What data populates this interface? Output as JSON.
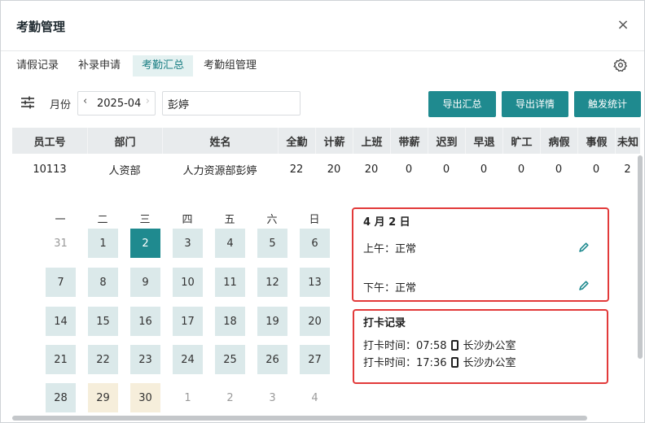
{
  "window": {
    "title": "考勤管理",
    "close_glyph": "×"
  },
  "tabs": [
    {
      "label": "请假记录",
      "active": false
    },
    {
      "label": "补录申请",
      "active": false
    },
    {
      "label": "考勤汇总",
      "active": true
    },
    {
      "label": "考勤组管理",
      "active": false
    }
  ],
  "toolbar": {
    "month_label": "月份",
    "month_value": "2025-04",
    "prev_glyph": "‹",
    "next_glyph": "›",
    "name_value": "彭婷",
    "export_summary": "导出汇总",
    "export_detail": "导出详情",
    "trigger_stats": "触发统计"
  },
  "table": {
    "headers": [
      "员工号",
      "部门",
      "姓名",
      "全勤",
      "计薪",
      "上班",
      "带薪",
      "迟到",
      "早退",
      "旷工",
      "病假",
      "事假",
      "未知"
    ],
    "rows": [
      [
        "10113",
        "人资部",
        "人力资源部彭婷",
        "22",
        "20",
        "20",
        "0",
        "0",
        "0",
        "0",
        "0",
        "0",
        "2"
      ]
    ]
  },
  "calendar": {
    "weekdays": [
      "一",
      "二",
      "三",
      "四",
      "五",
      "六",
      "日"
    ],
    "weeks": [
      [
        {
          "d": "31",
          "s": "other-shaded"
        },
        {
          "d": "1",
          "s": "normal"
        },
        {
          "d": "2",
          "s": "selected"
        },
        {
          "d": "3",
          "s": "normal"
        },
        {
          "d": "4",
          "s": "normal"
        },
        {
          "d": "5",
          "s": "normal"
        },
        {
          "d": "6",
          "s": "normal"
        }
      ],
      [
        {
          "d": "7",
          "s": "normal"
        },
        {
          "d": "8",
          "s": "normal"
        },
        {
          "d": "9",
          "s": "normal"
        },
        {
          "d": "10",
          "s": "normal"
        },
        {
          "d": "11",
          "s": "normal"
        },
        {
          "d": "12",
          "s": "normal"
        },
        {
          "d": "13",
          "s": "normal"
        }
      ],
      [
        {
          "d": "14",
          "s": "normal"
        },
        {
          "d": "15",
          "s": "normal"
        },
        {
          "d": "16",
          "s": "normal"
        },
        {
          "d": "17",
          "s": "normal"
        },
        {
          "d": "18",
          "s": "normal"
        },
        {
          "d": "19",
          "s": "normal"
        },
        {
          "d": "20",
          "s": "normal"
        }
      ],
      [
        {
          "d": "21",
          "s": "normal"
        },
        {
          "d": "22",
          "s": "normal"
        },
        {
          "d": "23",
          "s": "normal"
        },
        {
          "d": "24",
          "s": "normal"
        },
        {
          "d": "25",
          "s": "normal"
        },
        {
          "d": "26",
          "s": "normal"
        },
        {
          "d": "27",
          "s": "normal"
        }
      ],
      [
        {
          "d": "28",
          "s": "normal"
        },
        {
          "d": "29",
          "s": "warn"
        },
        {
          "d": "30",
          "s": "warn"
        },
        {
          "d": "1",
          "s": "other"
        },
        {
          "d": "2",
          "s": "other"
        },
        {
          "d": "3",
          "s": "other"
        },
        {
          "d": "4",
          "s": "other"
        }
      ]
    ]
  },
  "day_panel": {
    "title": "4 月 2 日",
    "morning": "上午：正常",
    "afternoon": "下午：正常"
  },
  "punch_panel": {
    "title": "打卡记录",
    "records": [
      {
        "label": "打卡时间：",
        "time": "07:58",
        "location": "长沙办公室"
      },
      {
        "label": "打卡时间：",
        "time": "17:36",
        "location": "长沙办公室"
      }
    ]
  },
  "colors": {
    "accent": "#1f8a8f",
    "highlight_border": "#e23a3a",
    "day_normal": "#dbe9ea",
    "day_warn": "#f6eedb"
  },
  "icons": {
    "close": "close-icon",
    "settings": "gear-icon",
    "filter": "sliders-icon",
    "edit": "pencil-icon",
    "phone": "phone-icon"
  }
}
